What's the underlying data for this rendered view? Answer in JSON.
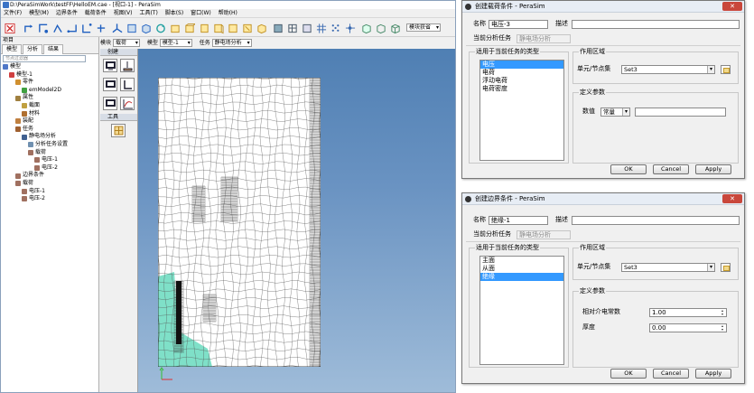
{
  "app": {
    "title": "D:\\PeraSimWork\\testFF\\HelloEM.cae - [视口-1] - PeraSim",
    "menu": [
      "文件(F)",
      "模型(M)",
      "边界条件",
      "载荷条件",
      "视图(V)",
      "工具(T)",
      "脚本(S)",
      "窗口(W)",
      "帮助(H)"
    ],
    "analysis_combo": "模块获省",
    "toolbar2": {
      "module_label": "模块",
      "module_value": "载荷",
      "model_label": "模型",
      "model_value": "模型-1",
      "task_label": "任务",
      "task_value": "静电场分析"
    }
  },
  "left_panel": {
    "header": "项目",
    "tabs": [
      "模型",
      "分析",
      "结果"
    ],
    "filter_placeholder": "节点过滤器",
    "tree": [
      {
        "level": 0,
        "label": "模型",
        "color": "#5078c8"
      },
      {
        "level": 1,
        "label": "模型-1",
        "color": "#d04040"
      },
      {
        "level": 2,
        "label": "零件",
        "color": "#d09030"
      },
      {
        "level": 3,
        "label": "emModel2D",
        "color": "#40a040"
      },
      {
        "level": 2,
        "label": "属性",
        "color": "#a08040"
      },
      {
        "level": 3,
        "label": "截面",
        "color": "#c0a040"
      },
      {
        "level": 3,
        "label": "材料",
        "color": "#b07030"
      },
      {
        "level": 2,
        "label": "装配",
        "color": "#c08040"
      },
      {
        "level": 2,
        "label": "任务",
        "color": "#a06030"
      },
      {
        "level": 3,
        "label": "静电场分析",
        "color": "#406090"
      },
      {
        "level": 4,
        "label": "分析任务设置",
        "color": "#7090b0"
      },
      {
        "level": 4,
        "label": "载荷",
        "color": "#a07060"
      },
      {
        "level": 5,
        "label": "电压-1",
        "color": "#a07060"
      },
      {
        "level": 5,
        "label": "电压-2",
        "color": "#a07060"
      },
      {
        "level": 2,
        "label": "边界条件",
        "color": "#a07060"
      },
      {
        "level": 2,
        "label": "载荷",
        "color": "#a07060"
      },
      {
        "level": 3,
        "label": "电压-1",
        "color": "#a07060"
      },
      {
        "level": 3,
        "label": "电压-2",
        "color": "#a07060"
      }
    ]
  },
  "create_panel": {
    "create_header": "创建",
    "tools_header": "工具"
  },
  "dialog_load": {
    "title": "创建载荷条件 - PeraSim",
    "name_label": "名称",
    "name_value": "电压-3",
    "desc_label": "描述",
    "desc_value": "",
    "task_label": "当前分析任务",
    "task_value": "静电场分析",
    "types_group": "适用于当前任务的类型",
    "types": [
      "电压",
      "电荷",
      "浮动电荷",
      "电荷密度"
    ],
    "selected_type": "电压",
    "region_group": "作用区域",
    "nodeset_label": "单元/节点集",
    "nodeset_value": "Set3",
    "params_group": "定义参数",
    "value_label": "数值",
    "value_mode": "常量",
    "value_input": "",
    "ok": "OK",
    "cancel": "Cancel",
    "apply": "Apply"
  },
  "dialog_bc": {
    "title": "创建边界条件 - PeraSim",
    "name_label": "名称",
    "name_value": "绝缘-1",
    "desc_label": "描述",
    "desc_value": "",
    "task_label": "当前分析任务",
    "task_value": "静电场分析",
    "types_group": "适用于当前任务的类型",
    "types": [
      "主面",
      "从面",
      "绝缘"
    ],
    "selected_type": "绝缘",
    "region_group": "作用区域",
    "nodeset_label": "单元/节点集",
    "nodeset_value": "Set3",
    "params_group": "定义参数",
    "permittivity_label": "相对介电常数",
    "permittivity_value": "1.00",
    "thickness_label": "厚度",
    "thickness_value": "0.00",
    "ok": "OK",
    "cancel": "Cancel",
    "apply": "Apply"
  },
  "colors": {
    "viewport_top": "#4f7fb3",
    "mesh_highlight": "#7fe0c8",
    "selection": "#3399ff"
  }
}
